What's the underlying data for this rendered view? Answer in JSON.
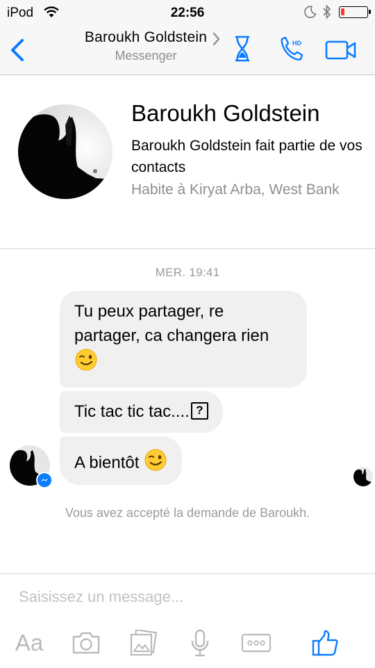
{
  "status_bar": {
    "carrier": "iPod",
    "time": "22:56",
    "battery_level": 0.15
  },
  "header": {
    "back_icon": "chevron-left-icon",
    "title": "Baroukh Goldstein",
    "title_chevron_icon": "chevron-right-icon",
    "subtitle": "Messenger",
    "actions": [
      {
        "icon": "hourglass-icon",
        "color": "#0a7cff"
      },
      {
        "icon": "hd-phone-icon",
        "color": "#0a7cff"
      },
      {
        "icon": "video-camera-icon",
        "color": "#0a7cff"
      }
    ]
  },
  "profile": {
    "name": "Baroukh Goldstein",
    "contact_status": "Baroukh Goldstein fait partie de vos contacts",
    "location": "Habite à Kiryat Arba, West Bank"
  },
  "conversation": {
    "timestamp": "MER. 19:41",
    "messages": [
      {
        "text": "Tu peux partager, re partager, ca changera rien",
        "emoji": "winking-face"
      },
      {
        "text": "Tic tac tic tac....",
        "trailing_glyph": "?"
      },
      {
        "text": "A bientôt",
        "emoji": "winking-face"
      }
    ],
    "system_note": "Vous avez accepté la demande de Baroukh."
  },
  "composer": {
    "placeholder": "Saisissez un message...",
    "toolbar": [
      {
        "icon": "text-format-icon",
        "label": "Aa"
      },
      {
        "icon": "camera-icon"
      },
      {
        "icon": "photo-gallery-icon"
      },
      {
        "icon": "microphone-icon"
      },
      {
        "icon": "more-icon"
      },
      {
        "icon": "like-thumb-icon",
        "color": "#0a7cff"
      }
    ]
  },
  "colors": {
    "accent": "#0a7cff",
    "bubble_bg": "#f1f0f0",
    "muted_text": "#8e8e93",
    "toolbar_icon": "#b9b9be"
  }
}
